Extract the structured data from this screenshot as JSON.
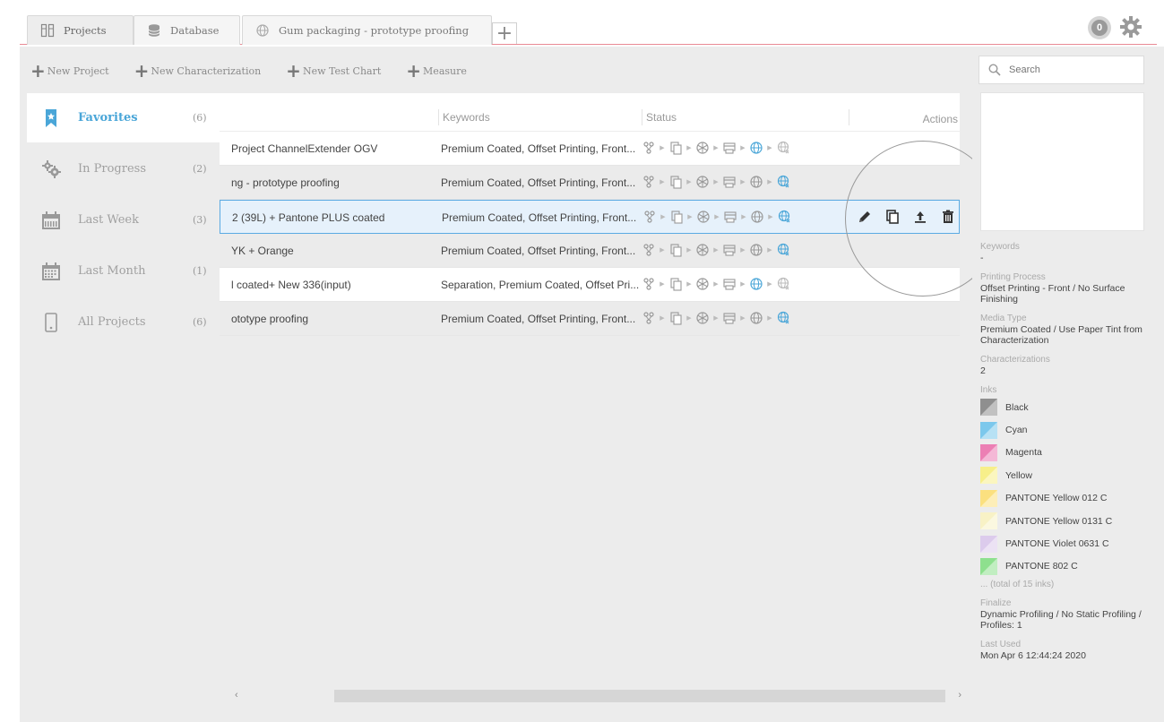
{
  "tabs": [
    {
      "label": "Projects",
      "icon": "projects-icon"
    },
    {
      "label": "Database",
      "icon": "database-icon"
    },
    {
      "label": "Gum packaging - prototype proofing",
      "icon": "globe-icon"
    }
  ],
  "notification_count": "0",
  "toolbar": {
    "new_project": "New Project",
    "new_characterization": "New Characterization",
    "new_test_chart": "New Test Chart",
    "measure": "Measure"
  },
  "sidebar": [
    {
      "label": "Favorites",
      "count": "(6)",
      "icon": "bookmark-star-icon"
    },
    {
      "label": "In Progress",
      "count": "(2)",
      "icon": "gears-icon"
    },
    {
      "label": "Last Week",
      "count": "(3)",
      "icon": "calendar-week-icon"
    },
    {
      "label": "Last Month",
      "count": "(1)",
      "icon": "calendar-month-icon"
    },
    {
      "label": "All Projects",
      "count": "(6)",
      "icon": "document-icon"
    }
  ],
  "table": {
    "columns": {
      "keywords": "Keywords",
      "status": "Status",
      "actions": "Actions"
    },
    "rows": [
      {
        "name": "Project ChannelExtender OGV",
        "keywords": "Premium Coated, Offset Printing, Front...",
        "progress": 3
      },
      {
        "name": "ng - prototype proofing",
        "keywords": "Premium Coated, Offset Printing, Front...",
        "progress": 5
      },
      {
        "name": "2 (39L) + Pantone PLUS coated",
        "keywords": "Premium Coated, Offset Printing, Front...",
        "progress": 5
      },
      {
        "name": "YK + Orange",
        "keywords": "Premium Coated, Offset Printing, Front...",
        "progress": 5
      },
      {
        "name": "l coated+ New 336(input)",
        "keywords": "Separation, Premium Coated, Offset Pri...",
        "progress": 4
      },
      {
        "name": "ototype proofing",
        "keywords": "Premium Coated, Offset Printing, Front...",
        "progress": 5
      }
    ]
  },
  "search": {
    "placeholder": "Search"
  },
  "details": {
    "keywords_label": "Keywords",
    "keywords_value": "-",
    "printing_process_label": "Printing Process",
    "printing_process_value": "Offset Printing - Front / No Surface Finishing",
    "media_type_label": "Media Type",
    "media_type_value": "Premium Coated / Use Paper Tint from Characterization",
    "characterizations_label": "Characterizations",
    "characterizations_value": "2",
    "inks_label": "Inks",
    "inks": [
      {
        "name": "Black",
        "color": "#8f8f8f"
      },
      {
        "name": "Cyan",
        "color": "#7cc8ec"
      },
      {
        "name": "Magenta",
        "color": "#ec7fb4"
      },
      {
        "name": "Yellow",
        "color": "#f7ef8a"
      },
      {
        "name": "PANTONE Yellow 012 C",
        "color": "#fbe07f"
      },
      {
        "name": "PANTONE Yellow 0131 C",
        "color": "#f8f2c6"
      },
      {
        "name": "PANTONE Violet 0631 C",
        "color": "#dccbec"
      },
      {
        "name": "PANTONE 802 C",
        "color": "#8ee08e"
      }
    ],
    "inks_more": "... (total of 15 inks)",
    "finalize_label": "Finalize",
    "finalize_value": "Dynamic Profiling / No Static Profiling / Profiles: 1",
    "last_used_label": "Last Used",
    "last_used_value": "Mon Apr 6 12:44:24 2020"
  },
  "colors": {
    "accent": "#4aa6d8",
    "tab_line": "#e98a94",
    "selection_border": "#5aaae3"
  }
}
